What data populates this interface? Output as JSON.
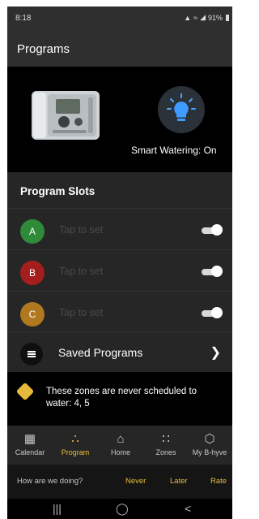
{
  "status_bar": {
    "time": "8:18",
    "battery": "91%"
  },
  "header": {
    "title": "Programs"
  },
  "device": {
    "smart_watering": "Smart Watering: On"
  },
  "slots": {
    "title": "Program Slots",
    "items": [
      {
        "letter": "A",
        "hint": "Tap to set",
        "color": "#2f8a3a"
      },
      {
        "letter": "B",
        "hint": "Tap to set",
        "color": "#a51e1e"
      },
      {
        "letter": "C",
        "hint": "Tap to set",
        "color": "#b0781f"
      }
    ]
  },
  "saved": {
    "label": "Saved Programs"
  },
  "notice": {
    "text": "These zones are never scheduled to water: 4, 5"
  },
  "nav": {
    "items": [
      {
        "label": "Calendar",
        "icon": "calendar-icon"
      },
      {
        "label": "Program",
        "icon": "program-icon",
        "active": true
      },
      {
        "label": "Home",
        "icon": "home-icon"
      },
      {
        "label": "Zones",
        "icon": "zones-icon"
      },
      {
        "label": "My B-hyve",
        "icon": "b-hyve-icon"
      }
    ]
  },
  "feedback": {
    "question": "How are we doing?",
    "never": "Never",
    "later": "Later",
    "rate": "Rate"
  },
  "colors": {
    "accent": "#e9bd3c",
    "panel": "#262626",
    "warning": "#e6b93a"
  }
}
